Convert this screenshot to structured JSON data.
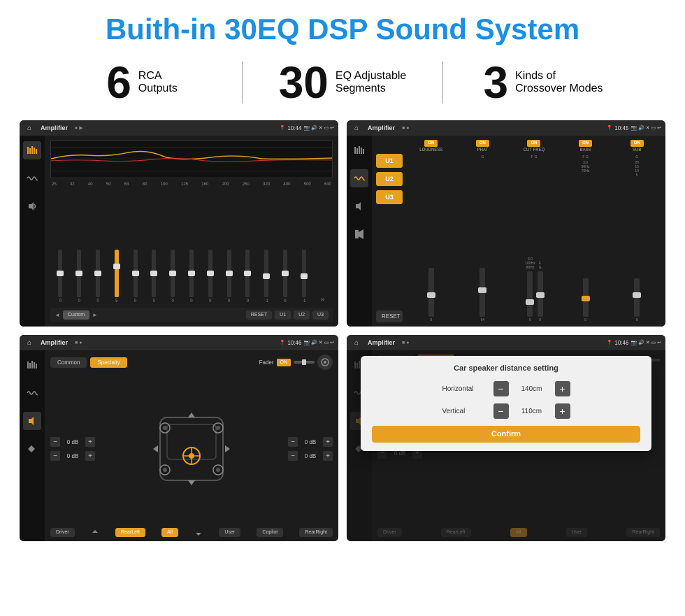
{
  "header": {
    "title": "Buith-in 30EQ DSP Sound System"
  },
  "stats": [
    {
      "number": "6",
      "text_line1": "RCA",
      "text_line2": "Outputs"
    },
    {
      "number": "30",
      "text_line1": "EQ Adjustable",
      "text_line2": "Segments"
    },
    {
      "number": "3",
      "text_line1": "Kinds of",
      "text_line2": "Crossover Modes"
    }
  ],
  "screens": {
    "eq": {
      "status_title": "Amplifier",
      "time": "10:44",
      "freq_labels": [
        "25",
        "32",
        "40",
        "50",
        "63",
        "80",
        "100",
        "125",
        "160",
        "200",
        "250",
        "320",
        "400",
        "500",
        "630"
      ],
      "slider_values": [
        "0",
        "0",
        "0",
        "5",
        "0",
        "0",
        "0",
        "0",
        "0",
        "0",
        "0",
        "-1",
        "0",
        "-1"
      ],
      "buttons": [
        "◄",
        "Custom",
        "►",
        "RESET",
        "U1",
        "U2",
        "U3"
      ]
    },
    "crossover": {
      "status_title": "Amplifier",
      "time": "10:45",
      "u_buttons": [
        "U1",
        "U2",
        "U3"
      ],
      "channels": [
        {
          "label": "LOUDNESS",
          "on": true
        },
        {
          "label": "PHAT",
          "on": true
        },
        {
          "label": "CUT FREQ",
          "on": true
        },
        {
          "label": "BASS",
          "on": true
        },
        {
          "label": "SUB",
          "on": true
        }
      ],
      "reset_label": "RESET"
    },
    "fader": {
      "status_title": "Amplifier",
      "time": "10:46",
      "tab_common": "Common",
      "tab_specialty": "Specialty",
      "fader_label": "Fader",
      "fader_on": "ON",
      "controls": [
        {
          "label": "",
          "value": "0 dB"
        },
        {
          "label": "",
          "value": "0 dB"
        },
        {
          "label": "",
          "value": "0 dB"
        },
        {
          "label": "",
          "value": "0 dB"
        }
      ],
      "bottom_buttons": [
        "Driver",
        "RearLeft",
        "All",
        "User",
        "Copilot",
        "RearRight"
      ]
    },
    "distance": {
      "status_title": "Amplifier",
      "time": "10:46",
      "tab_common": "Common",
      "tab_specialty": "Specialty",
      "dialog_title": "Car speaker distance setting",
      "horizontal_label": "Horizontal",
      "horizontal_value": "140cm",
      "vertical_label": "Vertical",
      "vertical_value": "110cm",
      "confirm_label": "Confirm",
      "bottom_buttons": [
        "Driver",
        "RearLeft",
        "All",
        "User",
        "RearRight"
      ],
      "right_controls": [
        "0 dB",
        "0 dB"
      ]
    }
  }
}
